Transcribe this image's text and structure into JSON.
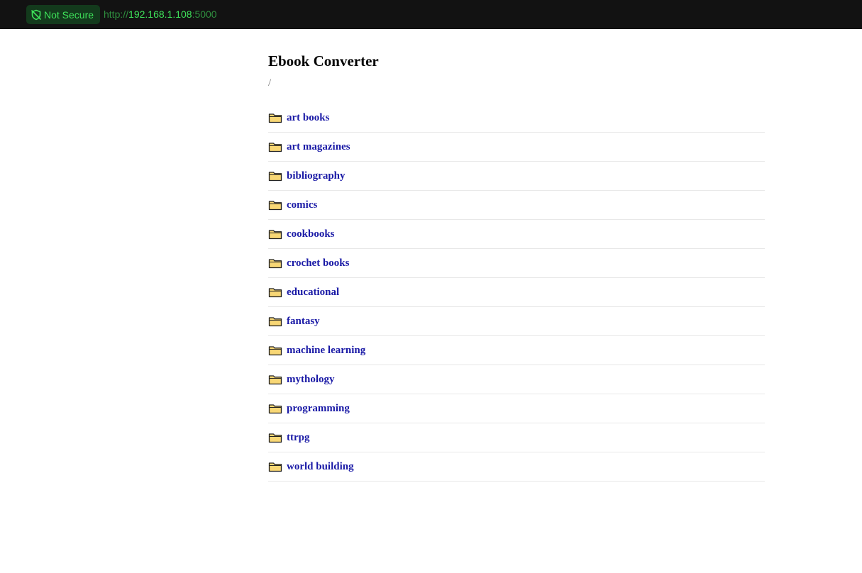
{
  "browser": {
    "security_label": "Not Secure",
    "url_scheme": "http://",
    "url_host": "192.168.1.108",
    "url_port": ":5000",
    "accent_color": "#3ee35a"
  },
  "page": {
    "title": "Ebook Converter",
    "path": "/"
  },
  "folders": [
    {
      "label": "art books",
      "icon": "folder-icon"
    },
    {
      "label": "art magazines",
      "icon": "folder-icon"
    },
    {
      "label": "bibliography",
      "icon": "folder-icon"
    },
    {
      "label": "comics",
      "icon": "folder-icon"
    },
    {
      "label": "cookbooks",
      "icon": "folder-icon"
    },
    {
      "label": "crochet books",
      "icon": "folder-icon"
    },
    {
      "label": "educational",
      "icon": "folder-icon"
    },
    {
      "label": "fantasy",
      "icon": "folder-icon"
    },
    {
      "label": "machine learning",
      "icon": "folder-icon"
    },
    {
      "label": "mythology",
      "icon": "folder-icon"
    },
    {
      "label": "programming",
      "icon": "folder-icon"
    },
    {
      "label": "ttrpg",
      "icon": "folder-icon"
    },
    {
      "label": "world building",
      "icon": "folder-icon"
    }
  ],
  "colors": {
    "link": "#1a1aa6",
    "folder_fill": "#f8d775",
    "folder_stroke": "#222222"
  }
}
